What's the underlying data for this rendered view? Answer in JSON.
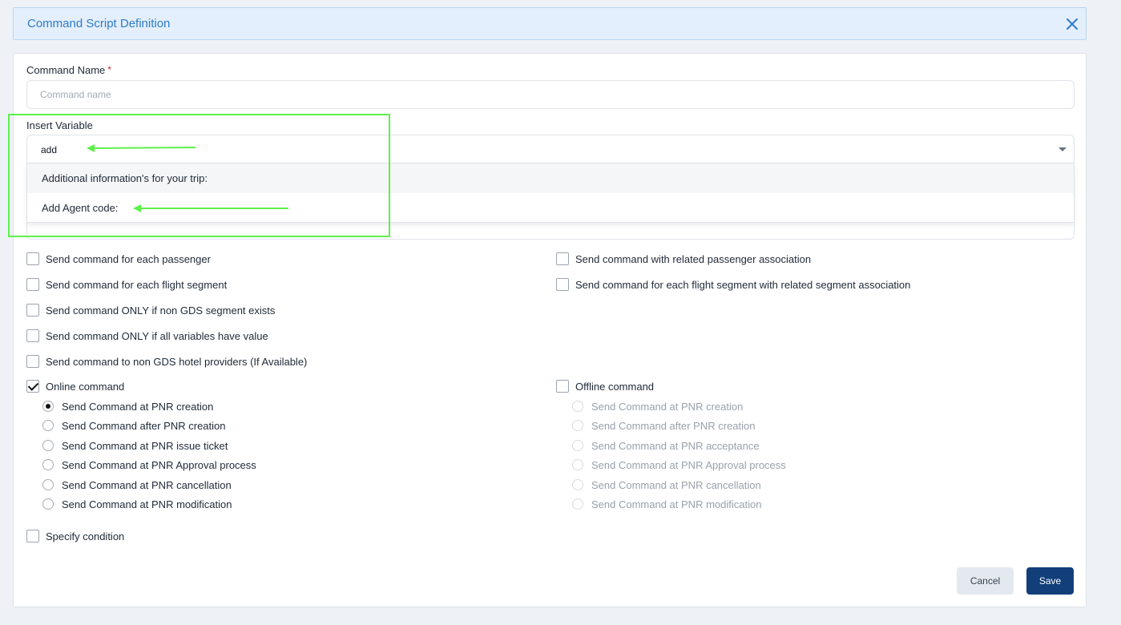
{
  "dialog": {
    "title": "Command Script Definition"
  },
  "command_name": {
    "label": "Command Name",
    "required_mark": "*",
    "placeholder": "Command name",
    "value": ""
  },
  "insert_variable": {
    "label": "Insert Variable",
    "search_value": "add",
    "options": [
      "Additional information's for your trip:",
      "Add Agent code:"
    ]
  },
  "checkboxes_left": [
    {
      "label": "Send command for each passenger",
      "checked": false
    },
    {
      "label": "Send command for each flight segment",
      "checked": false
    },
    {
      "label": "Send command ONLY if non GDS segment exists",
      "checked": false
    },
    {
      "label": "Send command ONLY if all variables have value",
      "checked": false
    },
    {
      "label": "Send command to non GDS hotel providers (If Available)",
      "checked": false
    }
  ],
  "checkboxes_right": [
    {
      "label": "Send command with related passenger association",
      "checked": false
    },
    {
      "label": "Send command for each flight segment with related segment association",
      "checked": false
    }
  ],
  "online": {
    "label": "Online command",
    "checked": true,
    "options": [
      "Send Command at PNR creation",
      "Send Command after PNR creation",
      "Send Command at PNR issue ticket",
      "Send Command at PNR Approval process",
      "Send Command at PNR cancellation",
      "Send Command at PNR modification"
    ],
    "selected": "Send Command at PNR creation"
  },
  "offline": {
    "label": "Offline command",
    "checked": false,
    "options": [
      "Send Command at PNR creation",
      "Send Command after PNR creation",
      "Send Command at PNR acceptance",
      "Send Command at PNR Approval process",
      "Send Command at PNR cancellation",
      "Send Command at PNR modification"
    ]
  },
  "specify_condition": {
    "label": "Specify condition",
    "checked": false
  },
  "buttons": {
    "cancel": "Cancel",
    "save": "Save"
  },
  "colors": {
    "header_bg": "#e3effc",
    "title_blue": "#2f7bc8",
    "save_bg": "#123f7a",
    "annotation_green": "#5ef04a"
  }
}
